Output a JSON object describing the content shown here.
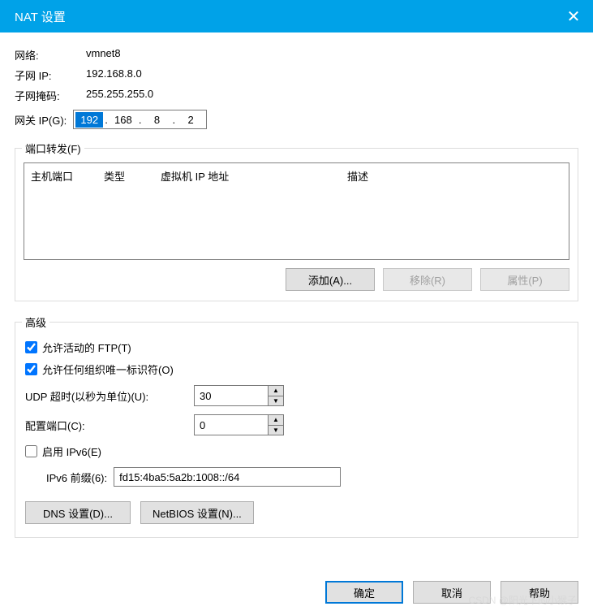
{
  "title": "NAT 设置",
  "info": {
    "network_label": "网络:",
    "network_value": "vmnet8",
    "subnet_ip_label": "子网 IP:",
    "subnet_ip_value": "192.168.8.0",
    "subnet_mask_label": "子网掩码:",
    "subnet_mask_value": "255.255.255.0"
  },
  "gateway": {
    "label": "网关 IP(G):",
    "oct1": "192",
    "oct2": "168",
    "oct3": "8",
    "oct4": "2"
  },
  "port_forward": {
    "legend": "端口转发(F)",
    "cols": {
      "host_port": "主机端口",
      "type": "类型",
      "vm_ip": "虚拟机 IP 地址",
      "desc": "描述"
    },
    "add": "添加(A)...",
    "remove": "移除(R)",
    "props": "属性(P)"
  },
  "advanced": {
    "legend": "高级",
    "allow_ftp": "允许活动的 FTP(T)",
    "allow_oui": "允许任何组织唯一标识符(O)",
    "udp_timeout_label": "UDP 超时(以秒为单位)(U):",
    "udp_timeout_value": "30",
    "config_port_label": "配置端口(C):",
    "config_port_value": "0",
    "enable_ipv6": "启用 IPv6(E)",
    "ipv6_prefix_label": "IPv6 前缀(6):",
    "ipv6_prefix_value": "fd15:4ba5:5a2b:1008::/64",
    "dns_btn": "DNS 设置(D)...",
    "netbios_btn": "NetBIOS 设置(N)..."
  },
  "footer": {
    "ok": "确定",
    "cancel": "取消",
    "help": "帮助"
  },
  "watermark": "CSDN @阳光下的小猴子"
}
